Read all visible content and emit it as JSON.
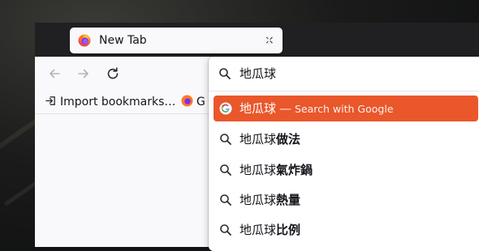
{
  "browser": {
    "tab": {
      "title": "New Tab",
      "close_glyph": "×"
    },
    "new_tab_glyph": "+",
    "nav": {
      "back_icon": "arrow-left-icon",
      "forward_icon": "arrow-right-icon",
      "reload_icon": "reload-icon"
    },
    "bookmarks": {
      "import_label": "Import bookmarks…",
      "second_label": "G"
    }
  },
  "urlbar": {
    "value": "地瓜球",
    "suggestions": [
      {
        "text": "地瓜球",
        "bold": "",
        "action": "Search with Google",
        "separator": "—",
        "selected": true,
        "icon": "google-icon"
      },
      {
        "text": "地瓜球",
        "bold": "做法",
        "selected": false,
        "icon": "search-icon"
      },
      {
        "text": "地瓜球",
        "bold": "氣炸鍋",
        "selected": false,
        "icon": "search-icon"
      },
      {
        "text": "地瓜球",
        "bold": "熱量",
        "selected": false,
        "icon": "search-icon"
      },
      {
        "text": "地瓜球",
        "bold": "比例",
        "selected": false,
        "icon": "search-icon"
      }
    ]
  },
  "colors": {
    "selected_row": "#e9572b",
    "tabstrip": "#202023",
    "toolbar": "#f9f9fb"
  }
}
